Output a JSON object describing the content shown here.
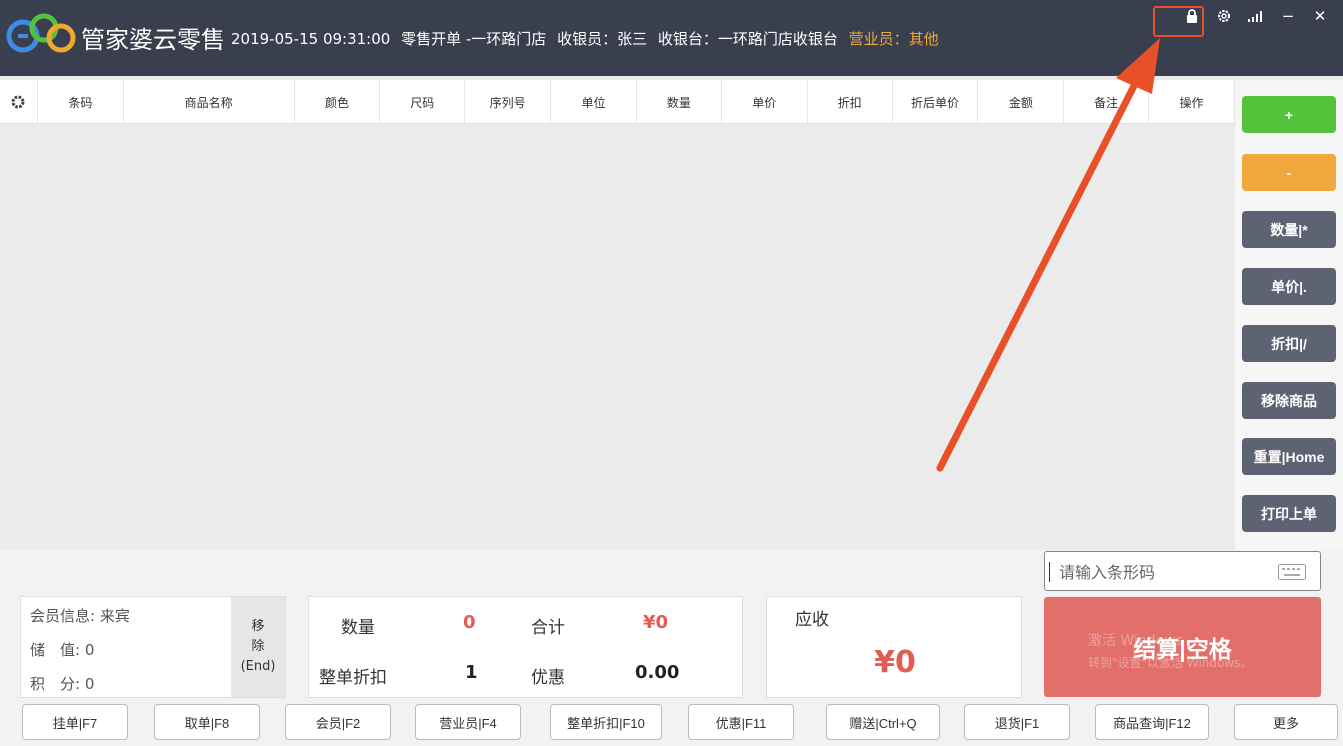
{
  "header": {
    "app_name": "管家婆云零售",
    "datetime": "2019-05-15 09:31:00",
    "mode": "零售开单 -一环路门店",
    "cashier": "收银员：张三",
    "register": "收银台：一环路门店收银台",
    "salesperson": "营业员：其他",
    "logo_icon": "eqo-cloud-logo",
    "controls": [
      "lock-icon",
      "gear-icon",
      "signal-icon",
      "minimize-icon",
      "close-icon"
    ],
    "minimize_glyph": "−",
    "close_glyph": "✕"
  },
  "table": {
    "settings_icon": "gear-icon",
    "columns": [
      "条码",
      "商品名称",
      "颜色",
      "尺码",
      "序列号",
      "单位",
      "数量",
      "单价",
      "折扣",
      "折后单价",
      "金额",
      "备注",
      "操作"
    ],
    "rows": []
  },
  "side_buttons": [
    "+",
    "-",
    "数量|*",
    "单价|.",
    "折扣|/",
    "移除商品",
    "重置|Home",
    "打印上单"
  ],
  "barcode": {
    "placeholder": "请输入条形码"
  },
  "member": {
    "info": "会员信息: 来宾",
    "stored_label": "储　值:",
    "stored_value": "0",
    "points_label": "积　分:",
    "points_value": "0",
    "remove_1": "移",
    "remove_2": "除",
    "remove_3": "(End)"
  },
  "summary": {
    "qty_label": "数量",
    "qty_value": "0",
    "total_label": "合计",
    "total_value": "¥0",
    "discount_label": "整单折扣",
    "discount_value": "1",
    "promo_label": "优惠",
    "promo_value": "0.00"
  },
  "due": {
    "label": "应收",
    "value": "¥0"
  },
  "checkout": {
    "label": "结算|空格",
    "watermark_1": "激活 Windows",
    "watermark_2": "转到\"设置\"以激活 Windows。"
  },
  "function_bar": [
    "挂单|F7",
    "取单|F8",
    "会员|F2",
    "营业员|F4",
    "整单折扣|F10",
    "优惠|F11",
    "赠送|Ctrl+Q",
    "退货|F1",
    "商品查询|F12",
    "更多"
  ],
  "colors": {
    "header_bg": "#3a3f4f",
    "accent_orange": "#f0a830",
    "green": "#55c23b",
    "red_amount": "#e25c50",
    "checkout": "#e26f6a",
    "annotation": "#e8502a"
  }
}
